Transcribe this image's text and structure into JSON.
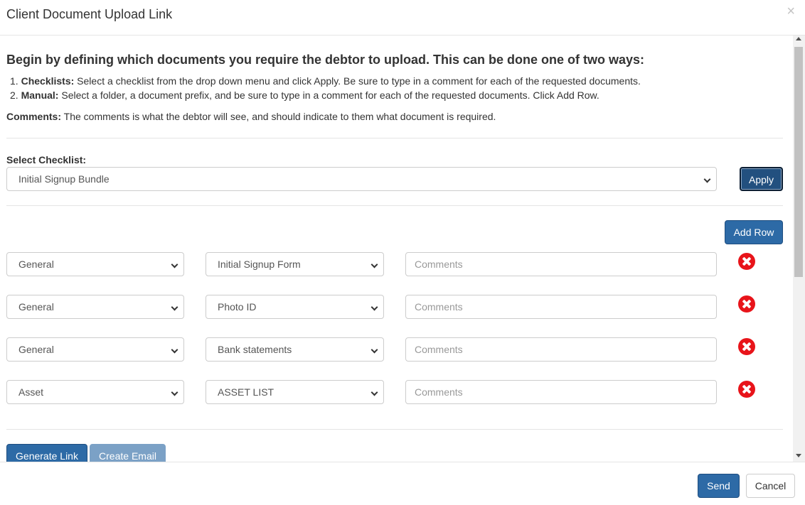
{
  "modal": {
    "title": "Client Document Upload Link",
    "close_symbol": "×"
  },
  "instructions": {
    "heading": "Begin by defining which documents you require the debtor to upload. This can be done one of two ways:",
    "items": [
      {
        "num": "1.",
        "bold": "Checklists:",
        "text": " Select a checklist from the drop down menu and click Apply. Be sure to type in a comment for each of the requested documents."
      },
      {
        "num": "2.",
        "bold": "Manual:",
        "text": " Select a folder, a document prefix, and be sure to type in a comment for each of the requested documents. Click Add Row."
      }
    ],
    "comments_bold": "Comments:",
    "comments_text": " The comments is what the debtor will see, and should indicate to them what document is required."
  },
  "checklist": {
    "label": "Select Checklist:",
    "selected": "Initial Signup Bundle",
    "apply_label": "Apply"
  },
  "add_row_label": "Add Row",
  "rows": [
    {
      "folder": "General",
      "document": "Initial Signup Form",
      "comment_placeholder": "Comments"
    },
    {
      "folder": "General",
      "document": "Photo ID",
      "comment_placeholder": "Comments"
    },
    {
      "folder": "General",
      "document": "Bank statements",
      "comment_placeholder": "Comments"
    },
    {
      "folder": "Asset",
      "document": "ASSET LIST",
      "comment_placeholder": "Comments"
    }
  ],
  "actions": {
    "generate_label": "Generate Link",
    "email_label": "Create Email"
  },
  "footer": {
    "send_label": "Send",
    "cancel_label": "Cancel"
  },
  "colors": {
    "primary": "#2d6aa6",
    "danger": "#e8141a",
    "disabled": "#7ba1c6"
  }
}
